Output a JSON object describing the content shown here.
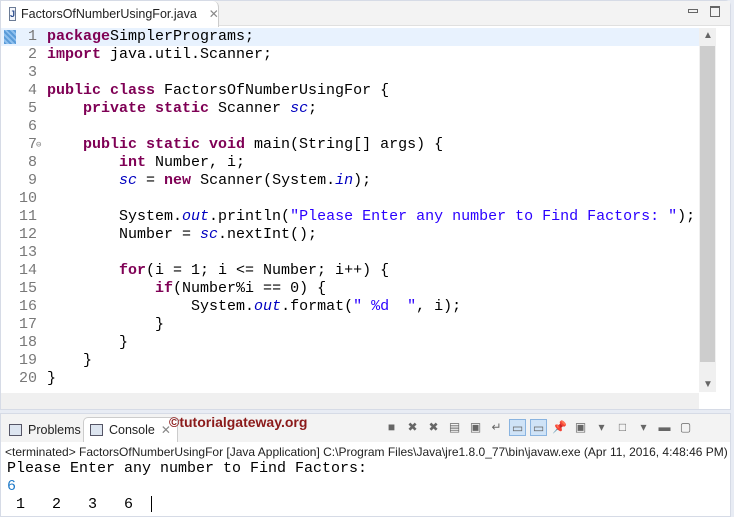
{
  "editor": {
    "tab_label": "FactorsOfNumberUsingFor.java",
    "lines": [
      [
        [
          "kw",
          "package"
        ],
        [
          "",
          "SimplerPrograms;"
        ]
      ],
      [
        [
          "kw",
          "import"
        ],
        [
          "",
          " java.util.Scanner;"
        ]
      ],
      [],
      [
        [
          "kw",
          "public class"
        ],
        [
          "",
          " FactorsOfNumberUsingFor {"
        ]
      ],
      [
        [
          "",
          "    "
        ],
        [
          "kw",
          "private static"
        ],
        [
          "",
          " Scanner "
        ],
        [
          "fld",
          "sc"
        ],
        [
          "",
          ";"
        ]
      ],
      [],
      [
        [
          "",
          "    "
        ],
        [
          "kw",
          "public static void"
        ],
        [
          "",
          " main(String[] args) {"
        ]
      ],
      [
        [
          "",
          "        "
        ],
        [
          "kw",
          "int"
        ],
        [
          "",
          " Number, i;"
        ]
      ],
      [
        [
          "",
          "        "
        ],
        [
          "fld",
          "sc"
        ],
        [
          "",
          " = "
        ],
        [
          "kw",
          "new"
        ],
        [
          "",
          " Scanner(System."
        ],
        [
          "fld",
          "in"
        ],
        [
          "",
          ");"
        ]
      ],
      [],
      [
        [
          "",
          "        System."
        ],
        [
          "fld",
          "out"
        ],
        [
          "",
          ".println("
        ],
        [
          "str",
          "\"Please Enter any number to Find Factors: \""
        ],
        [
          "",
          ");"
        ]
      ],
      [
        [
          "",
          "        Number = "
        ],
        [
          "fld",
          "sc"
        ],
        [
          "",
          ".nextInt();"
        ]
      ],
      [],
      [
        [
          "",
          "        "
        ],
        [
          "kw",
          "for"
        ],
        [
          "",
          "(i = 1; i <= Number; i++) {"
        ]
      ],
      [
        [
          "",
          "            "
        ],
        [
          "kw",
          "if"
        ],
        [
          "",
          "(Number%i == 0) {"
        ]
      ],
      [
        [
          "",
          "                System."
        ],
        [
          "fld",
          "out"
        ],
        [
          "",
          ".format("
        ],
        [
          "str",
          "\" %d  \""
        ],
        [
          "",
          ", i);"
        ]
      ],
      [
        [
          "",
          "            }"
        ]
      ],
      [
        [
          "",
          "        }"
        ]
      ],
      [
        [
          "",
          "    }"
        ]
      ],
      [
        [
          "",
          "}"
        ]
      ]
    ]
  },
  "console": {
    "tabs": [
      "Problems",
      "Console"
    ],
    "watermark": "©tutorialgateway.org",
    "status": "<terminated> FactorsOfNumberUsingFor [Java Application] C:\\Program Files\\Java\\jre1.8.0_77\\bin\\javaw.exe (Apr 11, 2016, 4:48:46 PM)",
    "output": [
      "Please Enter any number to Find Factors:",
      "6",
      " 1   2   3   6  "
    ]
  },
  "colors": {
    "keyword": "#7f0055",
    "field": "#0000c0",
    "string": "#2a00ff",
    "input": "#1f7ac8"
  }
}
